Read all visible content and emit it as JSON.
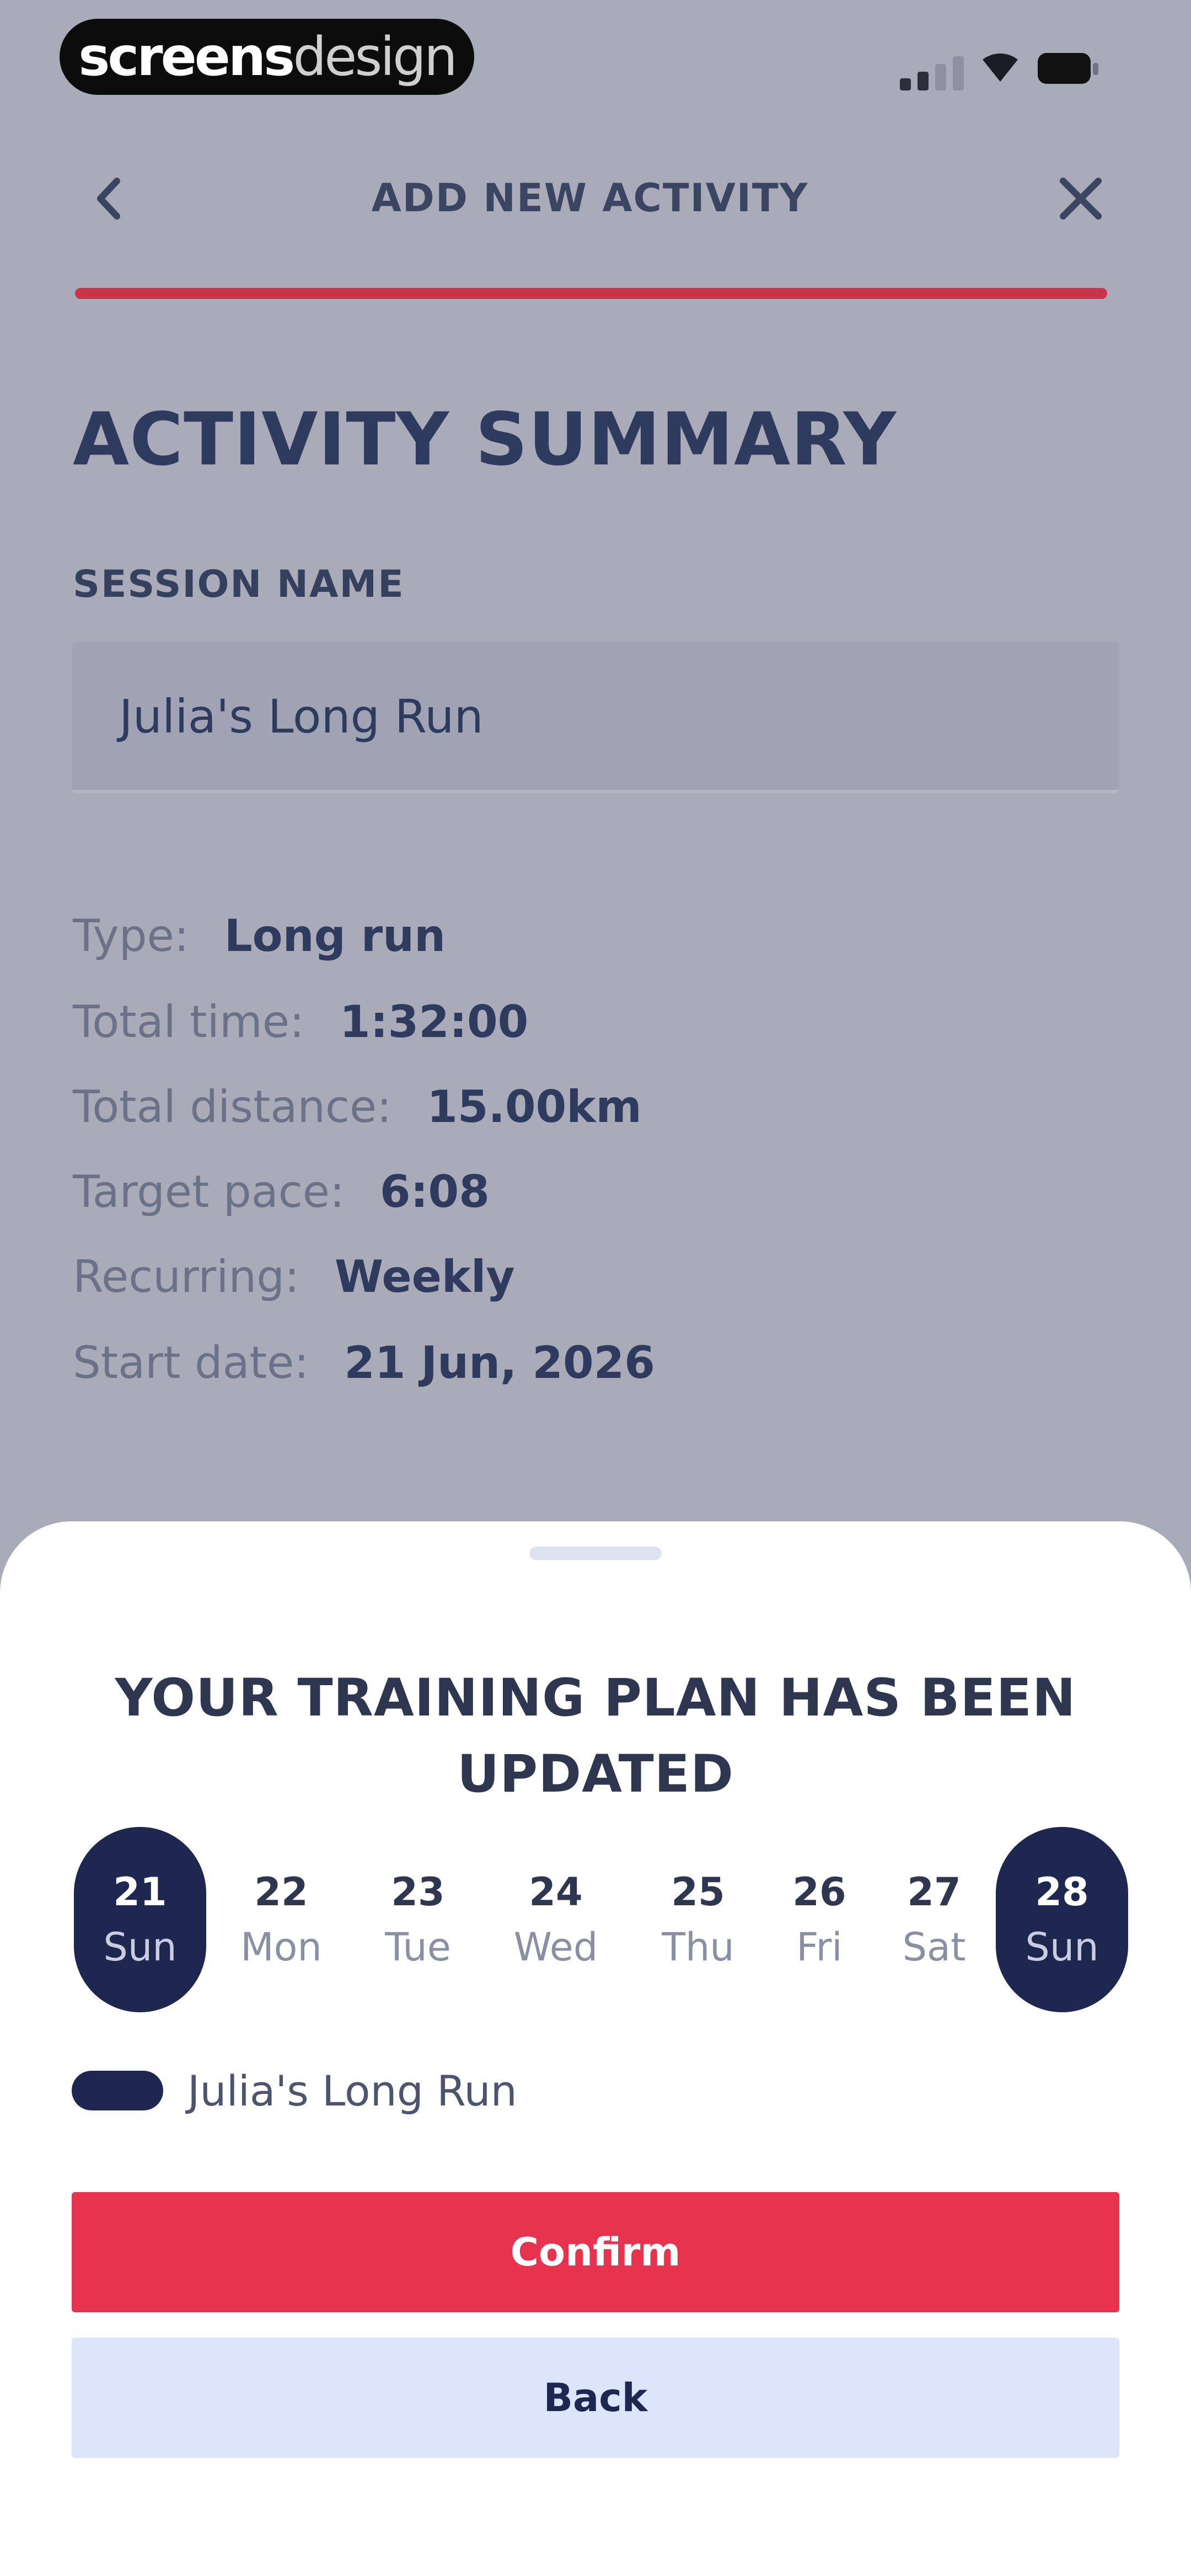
{
  "watermark": {
    "bold": "screens",
    "light": "design"
  },
  "header": {
    "title": "ADD NEW ACTIVITY",
    "progress_percent": 100
  },
  "summary": {
    "title": "ACTIVITY SUMMARY",
    "session_label": "SESSION NAME",
    "session_value": "Julia's Long Run",
    "details": [
      {
        "label": "Type:",
        "value": "Long run"
      },
      {
        "label": "Total time:",
        "value": "1:32:00"
      },
      {
        "label": "Total distance:",
        "value": "15.00km"
      },
      {
        "label": "Target pace:",
        "value": "6:08"
      },
      {
        "label": "Recurring:",
        "value": "Weekly"
      },
      {
        "label": "Start date:",
        "value": "21 Jun, 2026"
      }
    ]
  },
  "sheet": {
    "title": "YOUR TRAINING PLAN HAS BEEN UPDATED",
    "days": [
      {
        "num": "21",
        "name": "Sun",
        "selected": true
      },
      {
        "num": "22",
        "name": "Mon",
        "selected": false
      },
      {
        "num": "23",
        "name": "Tue",
        "selected": false
      },
      {
        "num": "24",
        "name": "Wed",
        "selected": false
      },
      {
        "num": "25",
        "name": "Thu",
        "selected": false
      },
      {
        "num": "26",
        "name": "Fri",
        "selected": false
      },
      {
        "num": "27",
        "name": "Sat",
        "selected": false
      },
      {
        "num": "28",
        "name": "Sun",
        "selected": true
      }
    ],
    "legend_label": "Julia's Long Run",
    "confirm_label": "Confirm",
    "back_label": "Back"
  },
  "icons": {
    "back": "chevron-left-icon",
    "close": "close-icon",
    "signal": "signal-icon",
    "wifi": "wifi-icon",
    "battery": "battery-icon"
  },
  "colors": {
    "accent": "#e8334f",
    "navy": "#1d2750",
    "overlay": "#a9abb8",
    "secondary_button": "#dde5fb"
  }
}
